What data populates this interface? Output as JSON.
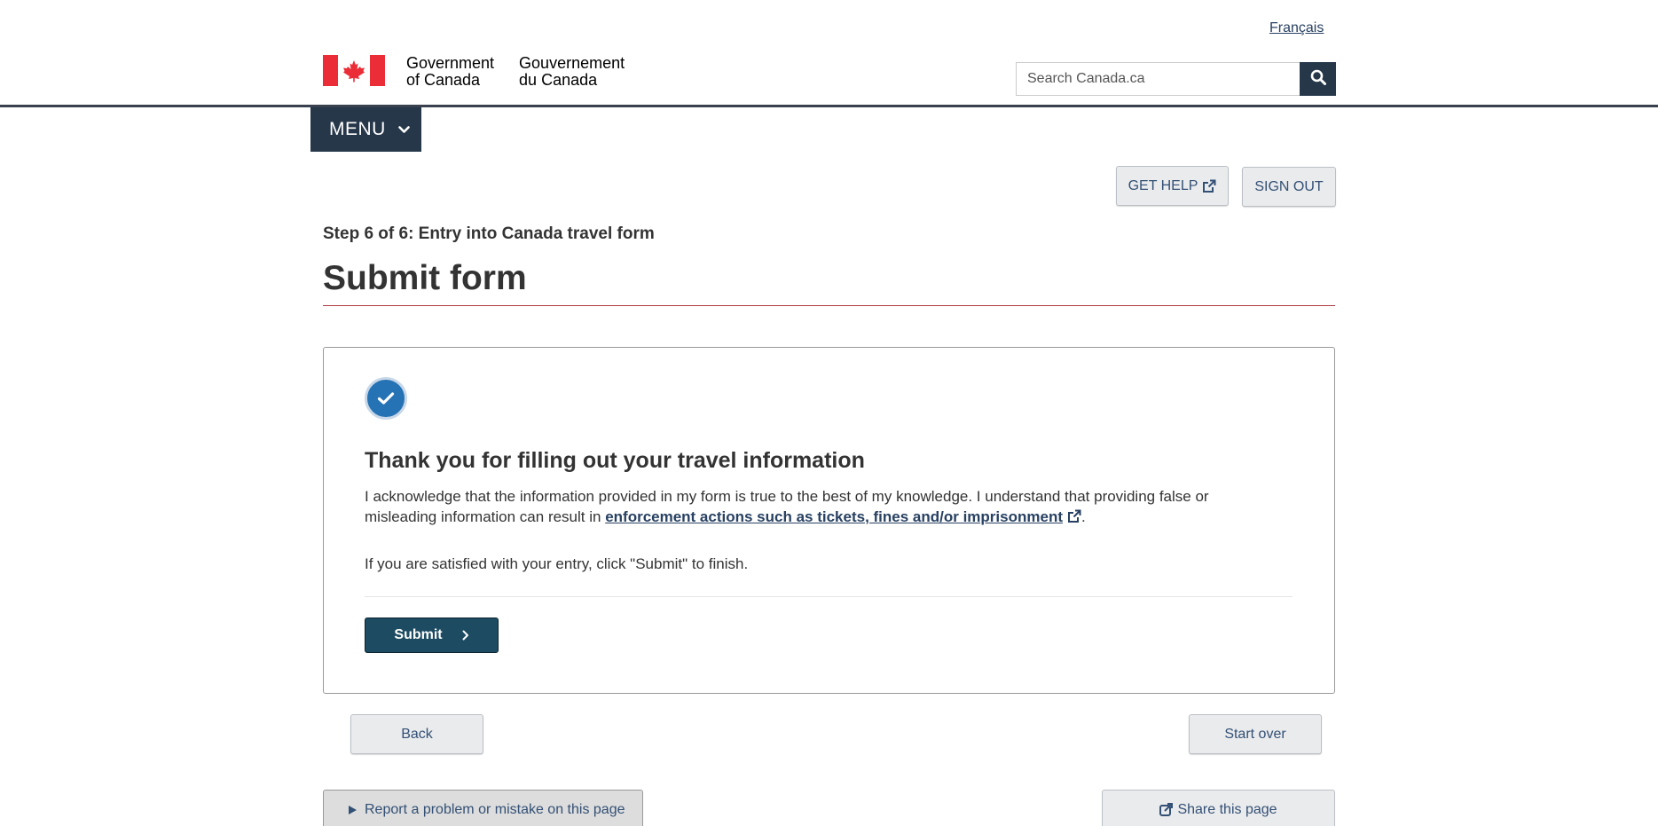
{
  "header": {
    "language_link": "Français",
    "signature": {
      "en_line1": "Government",
      "en_line2": "of Canada",
      "fr_line1": "Gouvernement",
      "fr_line2": "du Canada"
    },
    "search": {
      "placeholder": "Search Canada.ca",
      "button_icon": "search-icon"
    },
    "menu_label": "MENU"
  },
  "actions": {
    "get_help": "GET HELP",
    "sign_out": "SIGN OUT"
  },
  "page": {
    "step_label": "Step 6 of 6: Entry into Canada travel form",
    "title": "Submit form"
  },
  "confirmation": {
    "icon": "checkmark-icon",
    "heading": "Thank you for filling out your travel information",
    "acknowledgement_text": "I acknowledge that the information provided in my form is true to the best of my knowledge. I understand that providing false or misleading information can result in ",
    "acknowledgement_link": "enforcement actions such as tickets, fines and/or imprisonment",
    "acknowledgement_end": ".",
    "instruction": "If you are satisfied with your entry, click \"Submit\" to finish.",
    "submit_label": "Submit"
  },
  "navigation": {
    "back_label": "Back",
    "start_over_label": "Start over"
  },
  "footer": {
    "report_problem": "Report a problem or mistake on this page",
    "share_page": "Share this page"
  },
  "colors": {
    "brand_dark": "#26374a",
    "submit_bg": "#1c4b62",
    "flag_red": "#eb2d37",
    "title_rule": "#af3c43",
    "link": "#284162",
    "check_blue": "#2572b4"
  }
}
